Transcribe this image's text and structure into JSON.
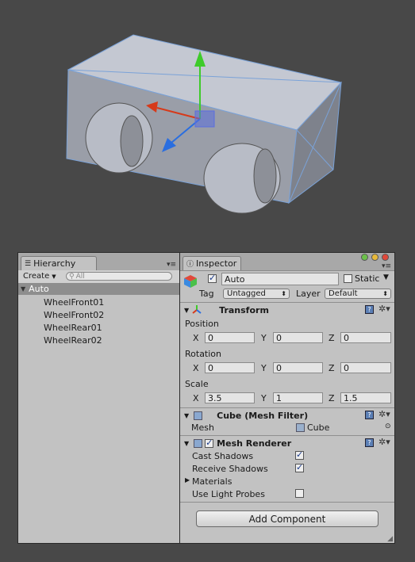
{
  "hierarchy": {
    "tab_label": "Hierarchy",
    "create_label": "Create",
    "search_placeholder": "All",
    "root": "Auto",
    "children": [
      "WheelFront01",
      "WheelFront02",
      "WheelRear01",
      "WheelRear02"
    ]
  },
  "inspector": {
    "tab_label": "Inspector",
    "object_name": "Auto",
    "static_label": "Static",
    "tag_label": "Tag",
    "tag_value": "Untagged",
    "layer_label": "Layer",
    "layer_value": "Default",
    "transform": {
      "title": "Transform",
      "position_label": "Position",
      "rotation_label": "Rotation",
      "scale_label": "Scale",
      "axis_x": "X",
      "axis_y": "Y",
      "axis_z": "Z",
      "position": {
        "x": "0",
        "y": "0",
        "z": "0"
      },
      "rotation": {
        "x": "0",
        "y": "0",
        "z": "0"
      },
      "scale": {
        "x": "3.5",
        "y": "1",
        "z": "1.5"
      }
    },
    "mesh_filter": {
      "title": "Cube (Mesh Filter)",
      "mesh_label": "Mesh",
      "mesh_value": "Cube"
    },
    "mesh_renderer": {
      "title": "Mesh Renderer",
      "cast_shadows_label": "Cast Shadows",
      "receive_shadows_label": "Receive Shadows",
      "materials_label": "Materials",
      "light_probes_label": "Use Light Probes"
    },
    "add_component_label": "Add Component"
  },
  "colors": {
    "scene_background": "#484848",
    "panel_background": "#c2c2c2",
    "selection": "#8e8e8e",
    "gizmo_y": "#3ecb2a",
    "gizmo_x": "#d63a1a",
    "gizmo_z": "#2a6ee0"
  }
}
